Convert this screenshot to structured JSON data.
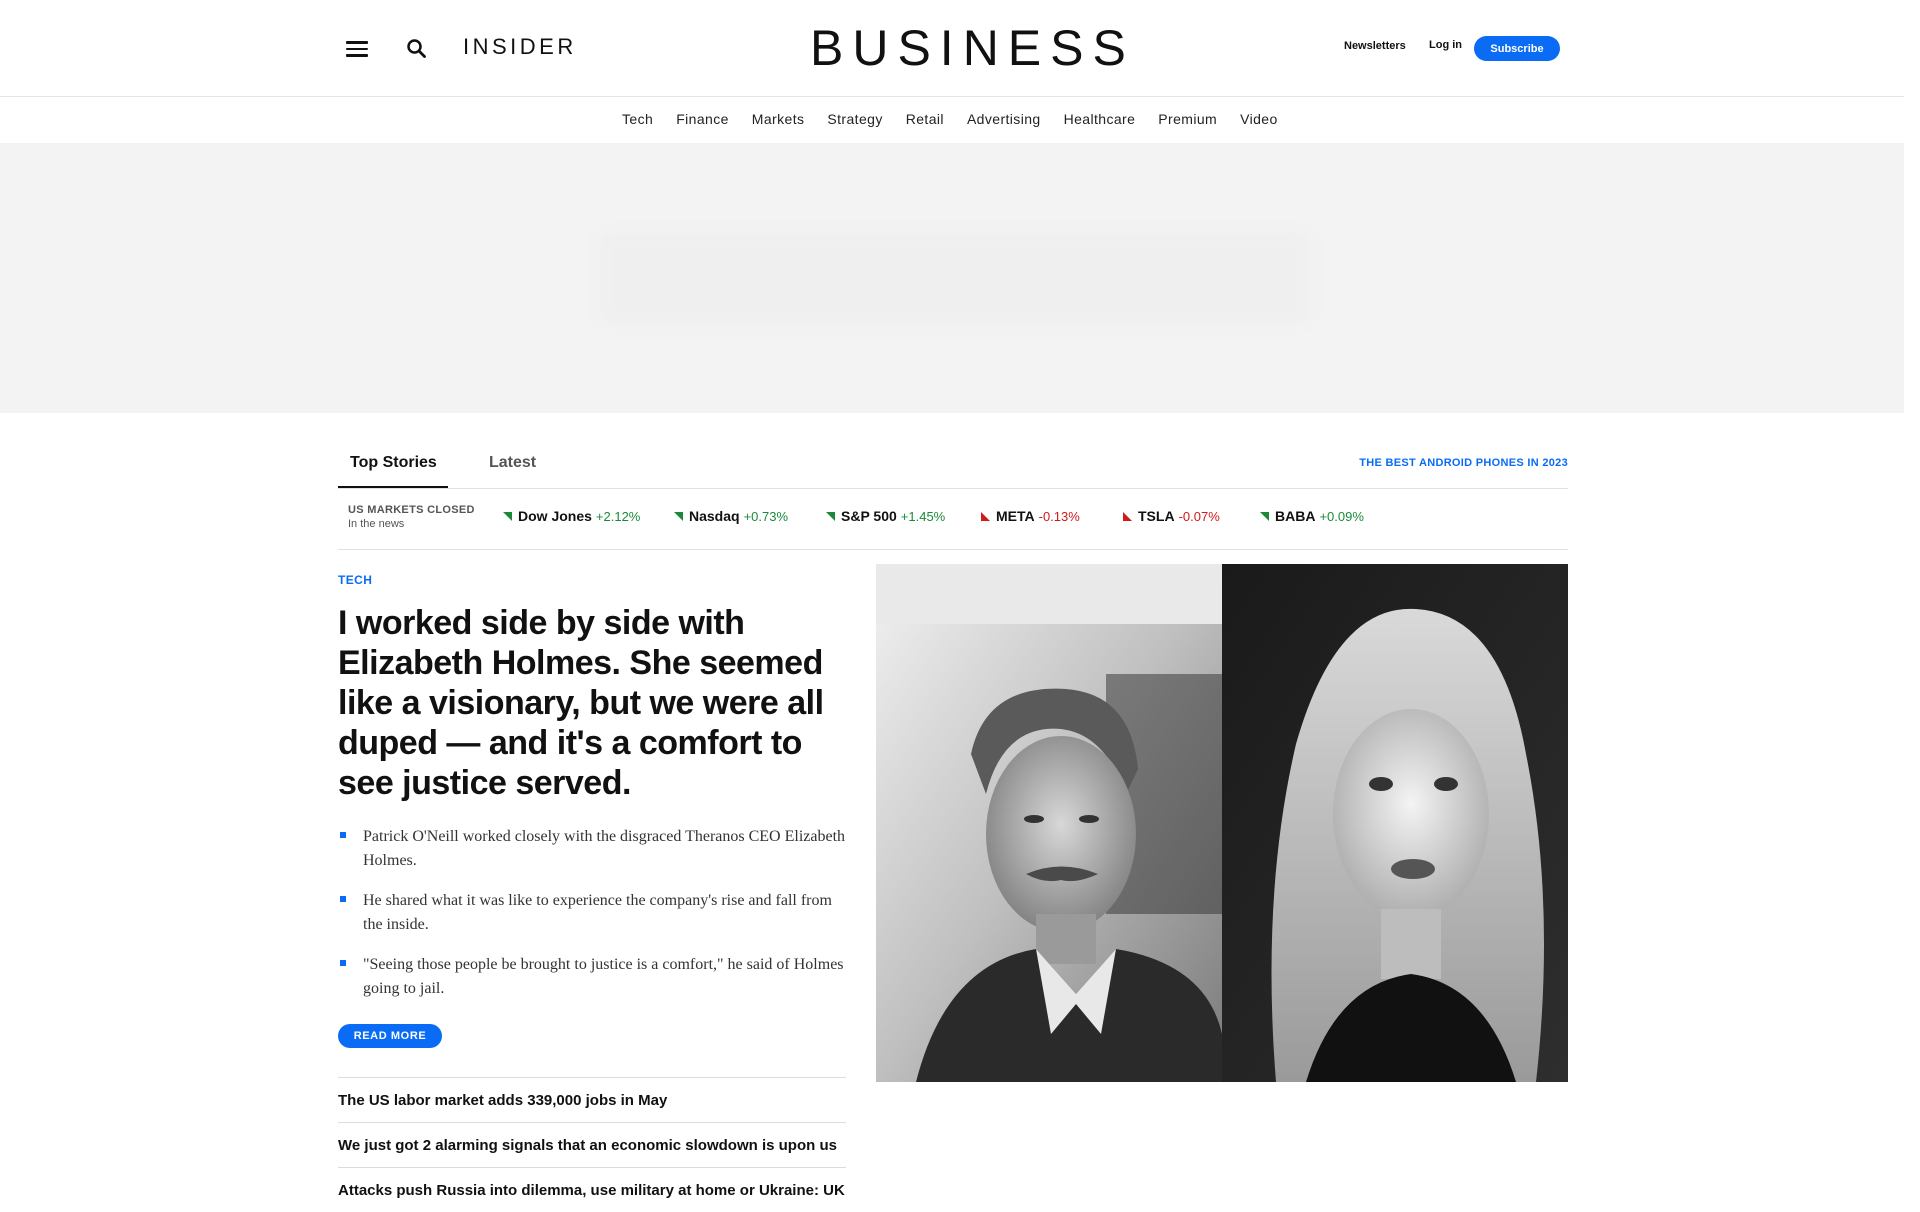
{
  "header": {
    "insider_label": "INSIDER",
    "business_label": "BUSINESS",
    "newsletters_label": "Newsletters",
    "login_label": "Log in",
    "subscribe_label": "Subscribe",
    "accent_color": "#0a6cf5"
  },
  "nav": {
    "items": [
      "Tech",
      "Finance",
      "Markets",
      "Strategy",
      "Retail",
      "Advertising",
      "Healthcare",
      "Premium",
      "Video"
    ]
  },
  "tabs": {
    "active": "Top Stories",
    "inactive": "Latest",
    "promo_link": "THE BEST ANDROID PHONES IN 2023"
  },
  "markets": {
    "status": "US MARKETS CLOSED",
    "subtitle": "In the news",
    "tickers": [
      {
        "name": "Dow Jones",
        "change": "+2.12%",
        "direction": "up"
      },
      {
        "name": "Nasdaq",
        "change": "+0.73%",
        "direction": "up"
      },
      {
        "name": "S&P 500",
        "change": "+1.45%",
        "direction": "up"
      },
      {
        "name": "META",
        "change": "-0.13%",
        "direction": "down"
      },
      {
        "name": "TSLA",
        "change": "-0.07%",
        "direction": "down"
      },
      {
        "name": "BABA",
        "change": "+0.09%",
        "direction": "up"
      }
    ]
  },
  "story": {
    "category": "TECH",
    "headline": "I worked side by side with Elizabeth Holmes. She seemed like a visionary, but we were all duped — and it's a comfort to see justice served.",
    "bullets": [
      "Patrick O'Neill worked closely with the disgraced Theranos CEO Elizabeth Holmes.",
      "He shared what it was like to experience the company's rise and fall from the inside.",
      "\"Seeing those people be brought to justice is a comfort,\" he said of Holmes going to jail."
    ],
    "read_more": "READ MORE"
  },
  "more_stories": [
    "The US labor market adds 339,000 jobs in May",
    "We just got 2 alarming signals that an economic slowdown is upon us",
    "Attacks push Russia into dilemma, use military at home or Ukraine: UK"
  ]
}
